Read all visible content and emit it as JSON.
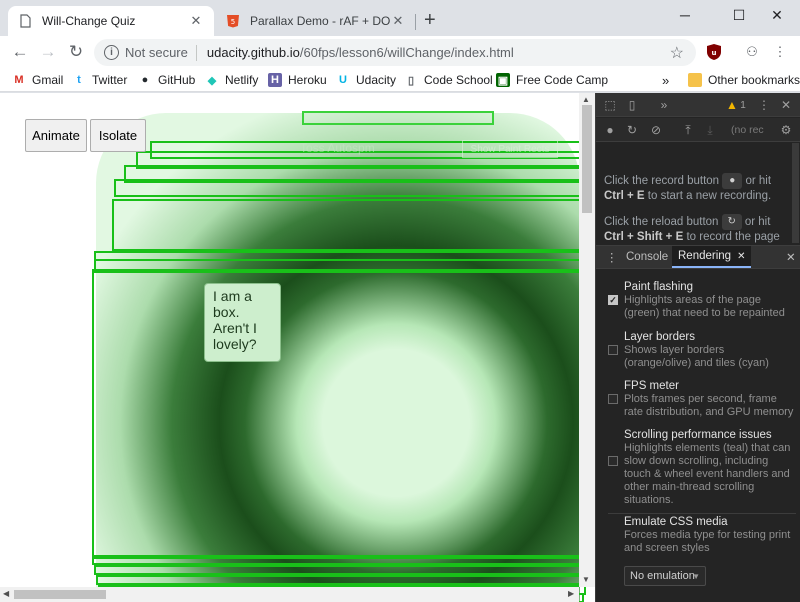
{
  "tabs": [
    {
      "title": "Will-Change Quiz",
      "active": true
    },
    {
      "title": "Parallax Demo - rAF + DOM + Wi",
      "active": false
    }
  ],
  "window_controls": {
    "minimize": "─",
    "maximize": "☐",
    "close": "✕"
  },
  "toolbar": {
    "back": "←",
    "forward": "→",
    "reload": "↻",
    "security_label": "Not secure",
    "url_host": "udacity.github.io",
    "url_path": "/60fps/lesson6/willChange/index.html",
    "star": "☆"
  },
  "bookmarks": [
    {
      "label": "Gmail",
      "icon": "M",
      "color": "#d93025"
    },
    {
      "label": "Twitter",
      "icon": "t",
      "color": "#1da1f2"
    },
    {
      "label": "GitHub",
      "icon": "●",
      "color": "#24292e"
    },
    {
      "label": "Netlify",
      "icon": "◆",
      "color": "#20c6b7"
    },
    {
      "label": "Heroku",
      "icon": "H",
      "color": "#6762a6"
    },
    {
      "label": "Udacity",
      "icon": "U",
      "color": "#02b3e4"
    },
    {
      "label": "Code School",
      "icon": "▯",
      "color": "#5f6368"
    },
    {
      "label": "Free Code Camp",
      "icon": "▣",
      "color": "#006400"
    }
  ],
  "bookmarks_overflow": "»",
  "other_bookmarks": "Other bookmarks",
  "page": {
    "animate_button": "Animate",
    "isolate_button": "Isolate",
    "ghost_text": "Toss Autospm",
    "ghost_button": "Show Paint Rects",
    "callout_text": "I am a box. Aren't I lovely?"
  },
  "devtools": {
    "warning_count": "1",
    "perf_placeholder": "(no rec",
    "record_msg_a": "Click the record button",
    "record_msg_b": "or hit",
    "record_shortcut": "Ctrl + E",
    "record_msg_c": "to start a new recording.",
    "reload_msg_a": "Click the reload button",
    "reload_msg_b": "or hit",
    "reload_shortcut": "Ctrl + Shift + E",
    "reload_msg_c": "to record the page",
    "drawer_tabs": [
      "Console",
      "Rendering"
    ],
    "rendering_options": [
      {
        "title": "Paint flashing",
        "desc": "Highlights areas of the page (green) that need to be repainted",
        "checked": true
      },
      {
        "title": "Layer borders",
        "desc": "Shows layer borders (orange/olive) and tiles (cyan)",
        "checked": false
      },
      {
        "title": "FPS meter",
        "desc": "Plots frames per second, frame rate distribution, and GPU memory",
        "checked": false
      },
      {
        "title": "Scrolling performance issues",
        "desc": "Highlights elements (teal) that can slow down scrolling, including touch & wheel event handlers and other main-thread scrolling situations.",
        "checked": false
      }
    ],
    "emulate_media_title": "Emulate CSS media",
    "emulate_media_desc": "Forces media type for testing print and screen styles",
    "emulate_media_value": "No emulation"
  }
}
